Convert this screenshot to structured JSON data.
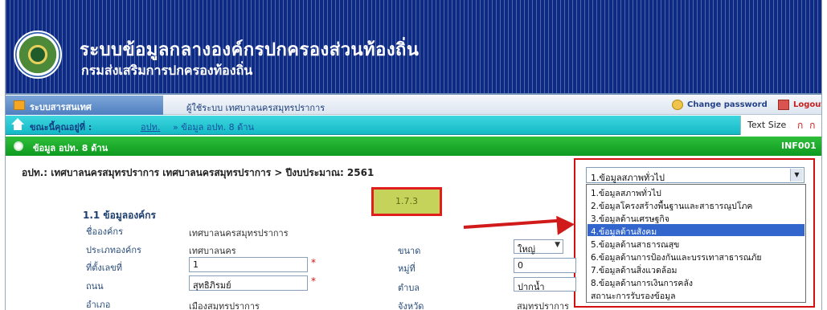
{
  "header": {
    "title": "ระบบข้อมูลกลางองค์กรปกครองส่วนท้องถิ่น",
    "subtitle": "กรมส่งเสริมการปกครองท้องถิ่น"
  },
  "topbar": {
    "system_tab": "ระบบสารสนเทศ",
    "user_label": "ผู้ใช้ระบบ เทศบาลนครสมุทรปราการ",
    "change_password": "Change password",
    "logout": "Logout"
  },
  "breadcrumb": {
    "label": "ขณะนี้คุณอยู่ที่ :",
    "item1": "อปท.",
    "item2": "» ข้อมูล อปท. 8 ด้าน",
    "text_size_label": "Text Size",
    "text_sizes": "ก ก ก"
  },
  "section_bar": {
    "title": "ข้อมูล อปท. 8 ด้าน",
    "code": "INF001"
  },
  "org_line": "อปท.: เทศบาลนครสมุทรปราการ เทศบาลนครสมุทรปราการ > ปีงบประมาณ: 2561",
  "category_select": {
    "selected": "1.ข้อมูลสภาพทั่วไป",
    "options": [
      "1.ข้อมูลสภาพทั่วไป",
      "2.ข้อมูลโครงสร้างพื้นฐานและสาธารณูปโภค",
      "3.ข้อมูลด้านเศรษฐกิจ",
      "4.ข้อมูลด้านสังคม",
      "5.ข้อมูลด้านสาธารณสุข",
      "6.ข้อมูลด้านการป้องกันและบรรเทาสาธารณภัย",
      "7.ข้อมูลด้านสิ่งแวดล้อม",
      "8.ข้อมูลด้านการเงินการคลัง",
      "สถานะการรับรองข้อมูล"
    ],
    "highlighted_index": 3
  },
  "annotation_badge": "1.7.3",
  "org_section": {
    "title": "1.1 ข้อมูลองค์กร",
    "name_label": "ชื่อองค์กร",
    "name_value": "เทศบาลนครสมุทรปราการ",
    "type_label": "ประเภทองค์กร",
    "type_value": "เทศบาลนคร",
    "size_label": "ขนาด",
    "size_value": "ใหญ่",
    "address_label": "ที่ตั้งเลขที่",
    "address_value": "1",
    "moo_label": "หมู่ที่",
    "moo_value": "0",
    "road_label": "ถนน",
    "road_value": "สุทธิภิรมย์",
    "tambon_label": "ตำบล",
    "tambon_value": "ปากน้ำ",
    "amphoe_label": "อำเภอ",
    "amphoe_value": "เมืองสมุทรปราการ",
    "province_label": "จังหวัด",
    "province_value": "สมุทรปราการ",
    "required_mark": "*"
  }
}
